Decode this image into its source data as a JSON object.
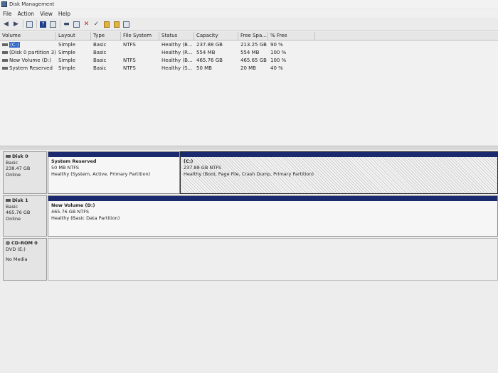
{
  "window": {
    "title": "Disk Management"
  },
  "menu": [
    "File",
    "Action",
    "View",
    "Help"
  ],
  "toolbar": {
    "icons": [
      "back-arrow-icon",
      "forward-arrow-icon",
      "list-icon",
      "help-icon",
      "console-icon",
      "properties-icon",
      "connect-icon",
      "delete-icon",
      "check-icon",
      "folder-icon",
      "format-icon"
    ]
  },
  "volume_list": {
    "columns": [
      "Volume",
      "Layout",
      "Type",
      "File System",
      "Status",
      "Capacity",
      "Free Spa...",
      "% Free"
    ],
    "rows": [
      [
        "(C:)",
        "Simple",
        "Basic",
        "NTFS",
        "Healthy (B...",
        "237.88 GB",
        "213.25 GB",
        "90 %"
      ],
      [
        "(Disk 0 partition 3)",
        "Simple",
        "Basic",
        "",
        "Healthy (R...",
        "554 MB",
        "554 MB",
        "100 %"
      ],
      [
        "New Volume (D:)",
        "Simple",
        "Basic",
        "NTFS",
        "Healthy (B...",
        "465.76 GB",
        "465.65 GB",
        "100 %"
      ],
      [
        "System Reserved",
        "Simple",
        "Basic",
        "NTFS",
        "Healthy (S...",
        "50 MB",
        "20 MB",
        "40 %"
      ]
    ]
  },
  "disks": [
    {
      "name": "Disk 0",
      "kind": "Basic",
      "size": "238.47 GB",
      "state": "Online",
      "partitions": [
        {
          "name": "System Reserved",
          "size": "50 MB NTFS",
          "status": "Healthy (System, Active, Primary Partition)"
        },
        {
          "name": "(C:)",
          "size": "237.88 GB NTFS",
          "status": "Healthy (Boot, Page File, Crash Dump, Primary Partition)"
        }
      ]
    },
    {
      "name": "Disk 1",
      "kind": "Basic",
      "size": "465.76 GB",
      "state": "Online",
      "partitions": [
        {
          "name": "New Volume (D:)",
          "size": "465.76 GB NTFS",
          "status": "Healthy (Basic Data Partition)"
        }
      ]
    },
    {
      "name": "CD-ROM 0",
      "kind": "DVD (E:)",
      "size": "",
      "state": "No Media",
      "partitions": []
    }
  ]
}
